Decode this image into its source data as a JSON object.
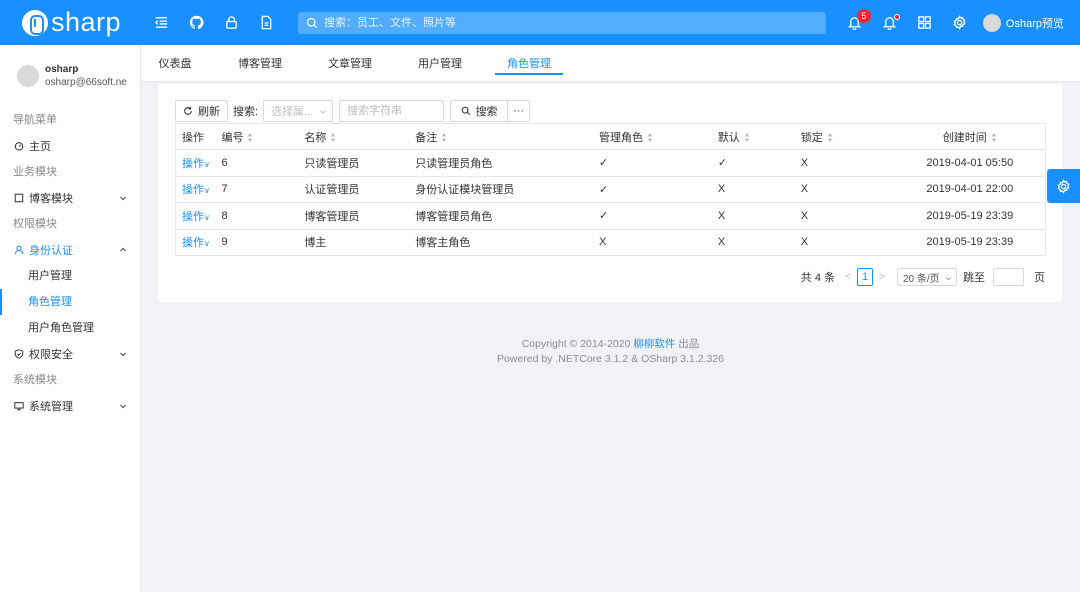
{
  "header": {
    "brand": "sharp",
    "search_placeholder": "搜索：员工、文件、照片等",
    "notification_count": "5",
    "user_name": "Osharp预览",
    "icons": [
      "menu-fold-icon",
      "github-icon",
      "lock-icon",
      "document-icon",
      "bell-icon",
      "notice-icon",
      "apps-icon",
      "gear-icon"
    ]
  },
  "sidebar": {
    "user": {
      "name": "osharp",
      "email": "osharp@66soft.ne"
    },
    "groups": {
      "nav": "导航菜单",
      "business": "业务模块",
      "permission": "权限模块",
      "system": "系统模块"
    },
    "items": {
      "home": "主页",
      "blog": "博客模块",
      "identity": "身份认证",
      "user_mgmt": "用户管理",
      "role_mgmt": "角色管理",
      "user_role_mgmt": "用户角色管理",
      "security": "权限安全",
      "system_mgmt": "系统管理"
    }
  },
  "tabs": [
    {
      "label": "仪表盘"
    },
    {
      "label": "博客管理"
    },
    {
      "label": "文章管理"
    },
    {
      "label": "用户管理"
    },
    {
      "label": "角色管理"
    }
  ],
  "toolbar": {
    "refresh": "刷新",
    "search_label": "搜索:",
    "field_placeholder": "选择属...",
    "keyword_placeholder": "搜索字符串",
    "search_button": "搜索",
    "more": "···"
  },
  "table": {
    "columns": [
      "操作",
      "编号",
      "名称",
      "备注",
      "管理角色",
      "默认",
      "锁定",
      "创建时间"
    ],
    "op_label": "操作",
    "rows": [
      {
        "id": "6",
        "name": "只读管理员",
        "remark": "只读管理员角色",
        "admin": "✓",
        "default": "✓",
        "locked": "X",
        "created": "2019-04-01 05:50"
      },
      {
        "id": "7",
        "name": "认证管理员",
        "remark": "身份认证模块管理员",
        "admin": "✓",
        "default": "X",
        "locked": "X",
        "created": "2019-04-01 22:00"
      },
      {
        "id": "8",
        "name": "博客管理员",
        "remark": "博客管理员角色",
        "admin": "✓",
        "default": "X",
        "locked": "X",
        "created": "2019-05-19 23:39"
      },
      {
        "id": "9",
        "name": "博主",
        "remark": "博客主角色",
        "admin": "X",
        "default": "X",
        "locked": "X",
        "created": "2019-05-19 23:39"
      }
    ]
  },
  "pager": {
    "total": "共 4 条",
    "current": "1",
    "page_size": "20 条/页",
    "jump_label": "跳至",
    "page_suffix": "页"
  },
  "footer": {
    "copyright_prefix": "Copyright © 2014-2020",
    "company": "柳柳软件",
    "copyright_suffix": "出品",
    "powered": "Powered by .NETCore 3.1.2 & OSharp 3.1.2.326"
  },
  "colors": {
    "primary": "#1890ff",
    "badge": "#f5222d"
  }
}
